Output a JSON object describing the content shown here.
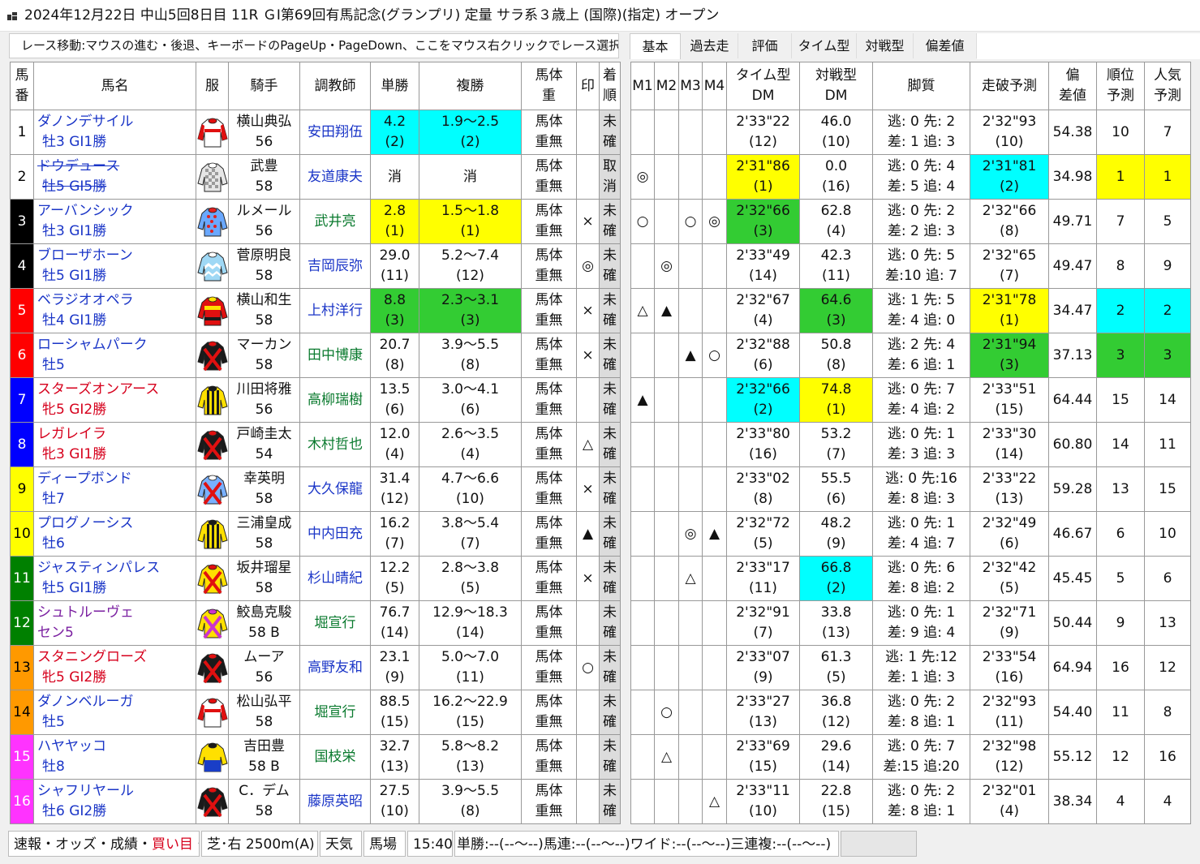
{
  "window_title": "2024年12月22日 中山5回8日目 11R ＧⅠ第69回有馬記念(グランプリ) 定量 サラ系３歳上 (国際)(指定) オープン",
  "nav_hint": "レース移動:マウスの進む・後退、キーボードのPageUp・PageDown、ここをマウス右クリックでレース選択",
  "tabs": [
    "基本",
    "過去走",
    "評価",
    "タイム型",
    "対戦型",
    "偏差値"
  ],
  "left_headers": [
    "馬番",
    "馬名",
    "服",
    "騎手",
    "調教師",
    "単勝",
    "複勝",
    "馬体重",
    "印",
    "着順"
  ],
  "right_headers": [
    "M1",
    "M2",
    "M3",
    "M4",
    "タイム型DM",
    "対戦型DM",
    "脚質",
    "走破予測",
    "偏差値",
    "順位予測",
    "人気予測"
  ],
  "colors": {
    "waku1": "#ffffff",
    "waku2": "#000000",
    "waku3": "#ff0000",
    "waku4": "#0000ff",
    "waku5": "#ffff00",
    "waku6": "#008000",
    "waku7": "#ff9900",
    "waku8": "#ff33ff",
    "hl_cyan": "#00ffff",
    "hl_yellow": "#ffff00",
    "hl_green": "#33cc33"
  },
  "horses": [
    {
      "num": "1",
      "waku": 1,
      "name": "ダノンデサイル",
      "info": "牡3 GⅠ1勝",
      "sex": "m",
      "silk": "red-white",
      "jockey": "横山典弘",
      "weight": "56",
      "trainer": "安田翔伍",
      "tc": "w",
      "win": "4.2",
      "win_rank": "(2)",
      "win_hl": "c",
      "place": "1.9～2.5",
      "place_rank": "(2)",
      "place_hl": "c",
      "bw1": "馬体",
      "bw2": "重無",
      "mark": "",
      "res1": "未",
      "res2": "確",
      "m": [
        "",
        "",
        "",
        ""
      ],
      "tdm": "2'33\"22",
      "tdm_r": "(12)",
      "tdm_hl": "",
      "vdm": "46.0",
      "vdm_r": "(10)",
      "vdm_hl": "",
      "ks1": "逃: 0 先: 2",
      "ks2": "差: 1 追: 3",
      "pred": "2'32\"93",
      "pred_r": "(10)",
      "pred_hl": "",
      "dev": "54.38",
      "rank": "10",
      "pop": "7",
      "rp_hl": ""
    },
    {
      "num": "2",
      "waku": 1,
      "name": "ドウデュース",
      "info": "牡5 GⅠ5勝",
      "sex": "m",
      "silk": "gray-check",
      "scr": true,
      "jockey": "武豊",
      "weight": "58",
      "trainer": "友道康夫",
      "tc": "w",
      "win": "消",
      "win_rank": "",
      "win_hl": "",
      "place": "消",
      "place_rank": "",
      "place_hl": "",
      "bw1": "馬体",
      "bw2": "重無",
      "mark": "",
      "res1": "取",
      "res2": "消",
      "m": [
        "◎",
        "",
        "",
        ""
      ],
      "tdm": "2'31\"86",
      "tdm_r": "(1)",
      "tdm_hl": "y",
      "vdm": "0.0",
      "vdm_r": "(16)",
      "vdm_hl": "",
      "ks1": "逃: 0 先: 4",
      "ks2": "差: 5 追: 4",
      "pred": "2'31\"81",
      "pred_r": "(2)",
      "pred_hl": "c",
      "dev": "34.98",
      "rank": "1",
      "pop": "1",
      "rp_hl": "y"
    },
    {
      "num": "3",
      "waku": 2,
      "name": "アーバンシック",
      "info": "牡3 GⅠ1勝",
      "sex": "m",
      "silk": "blue-dots",
      "jockey": "ルメール",
      "weight": "56",
      "trainer": "武井亮",
      "tc": "e",
      "win": "2.8",
      "win_rank": "(1)",
      "win_hl": "y",
      "place": "1.5～1.8",
      "place_rank": "(1)",
      "place_hl": "y",
      "bw1": "馬体",
      "bw2": "重無",
      "mark": "×",
      "res1": "未",
      "res2": "確",
      "m": [
        "○",
        "",
        "○",
        "◎"
      ],
      "tdm": "2'32\"66",
      "tdm_r": "(3)",
      "tdm_hl": "g",
      "vdm": "62.8",
      "vdm_r": "(4)",
      "vdm_hl": "",
      "ks1": "逃: 0 先: 2",
      "ks2": "差: 2 追: 3",
      "pred": "2'32\"66",
      "pred_r": "(8)",
      "pred_hl": "",
      "dev": "49.71",
      "rank": "7",
      "pop": "5",
      "rp_hl": ""
    },
    {
      "num": "4",
      "waku": 2,
      "name": "ブローザホーン",
      "info": "牡5 GⅠ1勝",
      "sex": "m",
      "silk": "lightblue-zig",
      "jockey": "菅原明良",
      "weight": "58",
      "trainer": "吉岡辰弥",
      "tc": "w",
      "win": "29.0",
      "win_rank": "(11)",
      "win_hl": "",
      "place": "5.2～7.4",
      "place_rank": "(12)",
      "place_hl": "",
      "bw1": "馬体",
      "bw2": "重無",
      "mark": "◎",
      "res1": "未",
      "res2": "確",
      "m": [
        "",
        "◎",
        "",
        ""
      ],
      "tdm": "2'33\"49",
      "tdm_r": "(14)",
      "tdm_hl": "",
      "vdm": "42.3",
      "vdm_r": "(11)",
      "vdm_hl": "",
      "ks1": "逃: 0 先: 5",
      "ks2": "差:10 追: 7",
      "pred": "2'32\"65",
      "pred_r": "(7)",
      "pred_hl": "",
      "dev": "49.47",
      "rank": "8",
      "pop": "9",
      "rp_hl": ""
    },
    {
      "num": "5",
      "waku": 3,
      "name": "ベラジオオペラ",
      "info": "牡4 GⅠ1勝",
      "sex": "m",
      "silk": "red-yellow",
      "jockey": "横山和生",
      "weight": "58",
      "trainer": "上村洋行",
      "tc": "w",
      "win": "8.8",
      "win_rank": "(3)",
      "win_hl": "g",
      "place": "2.3～3.1",
      "place_rank": "(3)",
      "place_hl": "g",
      "bw1": "馬体",
      "bw2": "重無",
      "mark": "×",
      "res1": "未",
      "res2": "確",
      "m": [
        "△",
        "▲",
        "",
        ""
      ],
      "tdm": "2'32\"67",
      "tdm_r": "(4)",
      "tdm_hl": "",
      "vdm": "64.6",
      "vdm_r": "(3)",
      "vdm_hl": "g",
      "ks1": "逃: 1 先: 5",
      "ks2": "差: 4 追: 0",
      "pred": "2'31\"78",
      "pred_r": "(1)",
      "pred_hl": "y",
      "dev": "34.47",
      "rank": "2",
      "pop": "2",
      "rp_hl": "c"
    },
    {
      "num": "6",
      "waku": 3,
      "name": "ローシャムパーク",
      "info": "牡5",
      "sex": "m",
      "silk": "black-x",
      "jockey": "マーカン",
      "weight": "58",
      "trainer": "田中博康",
      "tc": "e",
      "win": "20.7",
      "win_rank": "(8)",
      "win_hl": "",
      "place": "3.9～5.5",
      "place_rank": "(8)",
      "place_hl": "",
      "bw1": "馬体",
      "bw2": "重無",
      "mark": "×",
      "res1": "未",
      "res2": "確",
      "m": [
        "",
        "",
        "▲",
        "○"
      ],
      "tdm": "2'32\"88",
      "tdm_r": "(6)",
      "tdm_hl": "",
      "vdm": "50.8",
      "vdm_r": "(8)",
      "vdm_hl": "",
      "ks1": "逃: 2 先: 4",
      "ks2": "差: 6 追: 1",
      "pred": "2'31\"94",
      "pred_r": "(3)",
      "pred_hl": "g",
      "dev": "37.13",
      "rank": "3",
      "pop": "3",
      "rp_hl": "g"
    },
    {
      "num": "7",
      "waku": 4,
      "name": "スターズオンアース",
      "info": "牝5 GⅠ2勝",
      "sex": "f",
      "silk": "yellow-stripe",
      "jockey": "川田将雅",
      "weight": "56",
      "trainer": "高柳瑞樹",
      "tc": "e",
      "win": "13.5",
      "win_rank": "(6)",
      "win_hl": "",
      "place": "3.0～4.1",
      "place_rank": "(6)",
      "place_hl": "",
      "bw1": "馬体",
      "bw2": "重無",
      "mark": "",
      "res1": "未",
      "res2": "確",
      "m": [
        "▲",
        "",
        "",
        ""
      ],
      "tdm": "2'32\"66",
      "tdm_r": "(2)",
      "tdm_hl": "c",
      "vdm": "74.8",
      "vdm_r": "(1)",
      "vdm_hl": "y",
      "ks1": "逃: 0 先: 7",
      "ks2": "差: 4 追: 2",
      "pred": "2'33\"51",
      "pred_r": "(15)",
      "pred_hl": "",
      "dev": "64.44",
      "rank": "15",
      "pop": "14",
      "rp_hl": ""
    },
    {
      "num": "8",
      "waku": 4,
      "name": "レガレイラ",
      "info": "牝3 GⅠ1勝",
      "sex": "f",
      "silk": "black-x",
      "jockey": "戸崎圭太",
      "weight": "54",
      "trainer": "木村哲也",
      "tc": "e",
      "win": "12.0",
      "win_rank": "(4)",
      "win_hl": "",
      "place": "2.6～3.5",
      "place_rank": "(4)",
      "place_hl": "",
      "bw1": "馬体",
      "bw2": "重無",
      "mark": "△",
      "res1": "未",
      "res2": "確",
      "m": [
        "",
        "",
        "",
        ""
      ],
      "tdm": "2'33\"80",
      "tdm_r": "(16)",
      "tdm_hl": "",
      "vdm": "53.2",
      "vdm_r": "(7)",
      "vdm_hl": "",
      "ks1": "逃: 0 先: 1",
      "ks2": "差: 3 追: 3",
      "pred": "2'33\"30",
      "pred_r": "(14)",
      "pred_hl": "",
      "dev": "60.80",
      "rank": "14",
      "pop": "11",
      "rp_hl": ""
    },
    {
      "num": "9",
      "waku": 5,
      "name": "ディープボンド",
      "info": "牡7",
      "sex": "m",
      "silk": "blue-red-x",
      "jockey": "幸英明",
      "weight": "58",
      "trainer": "大久保龍",
      "tc": "w",
      "win": "31.4",
      "win_rank": "(12)",
      "win_hl": "",
      "place": "4.7～6.6",
      "place_rank": "(10)",
      "place_hl": "",
      "bw1": "馬体",
      "bw2": "重無",
      "mark": "×",
      "res1": "未",
      "res2": "確",
      "m": [
        "",
        "",
        "",
        ""
      ],
      "tdm": "2'33\"02",
      "tdm_r": "(8)",
      "tdm_hl": "",
      "vdm": "55.5",
      "vdm_r": "(6)",
      "vdm_hl": "",
      "ks1": "逃: 0 先:16",
      "ks2": "差: 8 追: 3",
      "pred": "2'33\"22",
      "pred_r": "(13)",
      "pred_hl": "",
      "dev": "59.28",
      "rank": "13",
      "pop": "15",
      "rp_hl": ""
    },
    {
      "num": "10",
      "waku": 5,
      "name": "プログノーシス",
      "info": "牡6",
      "sex": "m",
      "silk": "yellow-stripe",
      "jockey": "三浦皇成",
      "weight": "58",
      "trainer": "中内田充",
      "tc": "w",
      "win": "16.2",
      "win_rank": "(7)",
      "win_hl": "",
      "place": "3.8～5.4",
      "place_rank": "(7)",
      "place_hl": "",
      "bw1": "馬体",
      "bw2": "重無",
      "mark": "▲",
      "res1": "未",
      "res2": "確",
      "m": [
        "",
        "",
        "◎",
        "▲"
      ],
      "tdm": "2'32\"72",
      "tdm_r": "(5)",
      "tdm_hl": "",
      "vdm": "48.2",
      "vdm_r": "(9)",
      "vdm_hl": "",
      "ks1": "逃: 0 先: 1",
      "ks2": "差: 4 追: 7",
      "pred": "2'32\"49",
      "pred_r": "(6)",
      "pred_hl": "",
      "dev": "46.67",
      "rank": "6",
      "pop": "10",
      "rp_hl": ""
    },
    {
      "num": "11",
      "waku": 6,
      "name": "ジャスティンパレス",
      "info": "牡5 GⅠ1勝",
      "sex": "m",
      "silk": "yellow-red-x",
      "jockey": "坂井瑠星",
      "weight": "58",
      "trainer": "杉山晴紀",
      "tc": "w",
      "win": "12.2",
      "win_rank": "(5)",
      "win_hl": "",
      "place": "2.8～3.8",
      "place_rank": "(5)",
      "place_hl": "",
      "bw1": "馬体",
      "bw2": "重無",
      "mark": "×",
      "res1": "未",
      "res2": "確",
      "m": [
        "",
        "",
        "△",
        ""
      ],
      "tdm": "2'33\"17",
      "tdm_r": "(11)",
      "tdm_hl": "",
      "vdm": "66.8",
      "vdm_r": "(2)",
      "vdm_hl": "c",
      "ks1": "逃: 0 先: 6",
      "ks2": "差: 8 追: 2",
      "pred": "2'32\"42",
      "pred_r": "(5)",
      "pred_hl": "",
      "dev": "45.45",
      "rank": "5",
      "pop": "6",
      "rp_hl": ""
    },
    {
      "num": "12",
      "waku": 6,
      "name": "シュトルーヴェ",
      "info": "セン5",
      "sex": "g",
      "silk": "yellow-pink-x",
      "jockey": "鮫島克駿",
      "weight": "58 B",
      "trainer": "堀宣行",
      "tc": "e",
      "win": "76.7",
      "win_rank": "(14)",
      "win_hl": "",
      "place": "12.9～18.3",
      "place_rank": "(14)",
      "place_hl": "",
      "bw1": "馬体",
      "bw2": "重無",
      "mark": "",
      "res1": "未",
      "res2": "確",
      "m": [
        "",
        "",
        "",
        ""
      ],
      "tdm": "2'32\"91",
      "tdm_r": "(7)",
      "tdm_hl": "",
      "vdm": "33.8",
      "vdm_r": "(13)",
      "vdm_hl": "",
      "ks1": "逃: 0 先: 1",
      "ks2": "差: 9 追: 4",
      "pred": "2'32\"71",
      "pred_r": "(9)",
      "pred_hl": "",
      "dev": "50.44",
      "rank": "9",
      "pop": "13",
      "rp_hl": ""
    },
    {
      "num": "13",
      "waku": 7,
      "name": "スタニングローズ",
      "info": "牝5 GⅠ2勝",
      "sex": "f",
      "silk": "black-x",
      "jockey": "ムーア",
      "weight": "56",
      "trainer": "高野友和",
      "tc": "w",
      "win": "23.1",
      "win_rank": "(9)",
      "win_hl": "",
      "place": "5.0～7.0",
      "place_rank": "(11)",
      "place_hl": "",
      "bw1": "馬体",
      "bw2": "重無",
      "mark": "○",
      "res1": "未",
      "res2": "確",
      "m": [
        "",
        "",
        "",
        ""
      ],
      "tdm": "2'33\"07",
      "tdm_r": "(9)",
      "tdm_hl": "",
      "vdm": "61.3",
      "vdm_r": "(5)",
      "vdm_hl": "",
      "ks1": "逃: 1 先:12",
      "ks2": "差: 1 追: 3",
      "pred": "2'33\"54",
      "pred_r": "(16)",
      "pred_hl": "",
      "dev": "64.94",
      "rank": "16",
      "pop": "12",
      "rp_hl": ""
    },
    {
      "num": "14",
      "waku": 7,
      "name": "ダノンベルーガ",
      "info": "牡5",
      "sex": "m",
      "silk": "red-white",
      "jockey": "松山弘平",
      "weight": "58",
      "trainer": "堀宣行",
      "tc": "e",
      "win": "88.5",
      "win_rank": "(15)",
      "win_hl": "",
      "place": "16.2～22.9",
      "place_rank": "(15)",
      "place_hl": "",
      "bw1": "馬体",
      "bw2": "重無",
      "mark": "",
      "res1": "未",
      "res2": "確",
      "m": [
        "",
        "○",
        "",
        ""
      ],
      "tdm": "2'33\"27",
      "tdm_r": "(13)",
      "tdm_hl": "",
      "vdm": "36.8",
      "vdm_r": "(12)",
      "vdm_hl": "",
      "ks1": "逃: 0 先: 2",
      "ks2": "差: 8 追: 1",
      "pred": "2'32\"93",
      "pred_r": "(11)",
      "pred_hl": "",
      "dev": "54.40",
      "rank": "11",
      "pop": "8",
      "rp_hl": ""
    },
    {
      "num": "15",
      "waku": 8,
      "name": "ハヤヤッコ",
      "info": "牡8",
      "sex": "m",
      "silk": "yellow-blue",
      "jockey": "吉田豊",
      "weight": "58 B",
      "trainer": "国枝栄",
      "tc": "e",
      "win": "32.7",
      "win_rank": "(13)",
      "win_hl": "",
      "place": "5.8～8.2",
      "place_rank": "(13)",
      "place_hl": "",
      "bw1": "馬体",
      "bw2": "重無",
      "mark": "",
      "res1": "未",
      "res2": "確",
      "m": [
        "",
        "△",
        "",
        ""
      ],
      "tdm": "2'33\"69",
      "tdm_r": "(15)",
      "tdm_hl": "",
      "vdm": "29.6",
      "vdm_r": "(14)",
      "vdm_hl": "",
      "ks1": "逃: 0 先: 7",
      "ks2": "差:15 追:20",
      "pred": "2'32\"98",
      "pred_r": "(12)",
      "pred_hl": "",
      "dev": "55.12",
      "rank": "12",
      "pop": "16",
      "rp_hl": ""
    },
    {
      "num": "16",
      "waku": 8,
      "name": "シャフリヤール",
      "info": "牡6 GⅠ2勝",
      "sex": "m",
      "silk": "black-x",
      "jockey": "C．デム",
      "weight": "58",
      "trainer": "藤原英昭",
      "tc": "w",
      "win": "27.5",
      "win_rank": "(10)",
      "win_hl": "",
      "place": "3.9～5.5",
      "place_rank": "(8)",
      "place_hl": "",
      "bw1": "馬体",
      "bw2": "重無",
      "mark": "",
      "res1": "未",
      "res2": "確",
      "m": [
        "",
        "",
        "",
        "△"
      ],
      "tdm": "2'33\"11",
      "tdm_r": "(10)",
      "tdm_hl": "",
      "vdm": "22.8",
      "vdm_r": "(15)",
      "vdm_hl": "",
      "ks1": "逃: 0 先: 2",
      "ks2": "差: 8 追: 1",
      "pred": "2'32\"01",
      "pred_r": "(4)",
      "pred_hl": "",
      "dev": "38.34",
      "rank": "4",
      "pop": "4",
      "rp_hl": ""
    }
  ],
  "status": {
    "links": [
      "速報",
      "オッズ",
      "成績",
      "買い目"
    ],
    "sep": "・",
    "course": "芝･右 2500m(A)",
    "weather": "天気",
    "track": "馬場",
    "time": "15:40",
    "odds": "単勝:--(--～--)馬連:--(--～--)ワイド:--(--～--)三連複:--(--～--)"
  }
}
